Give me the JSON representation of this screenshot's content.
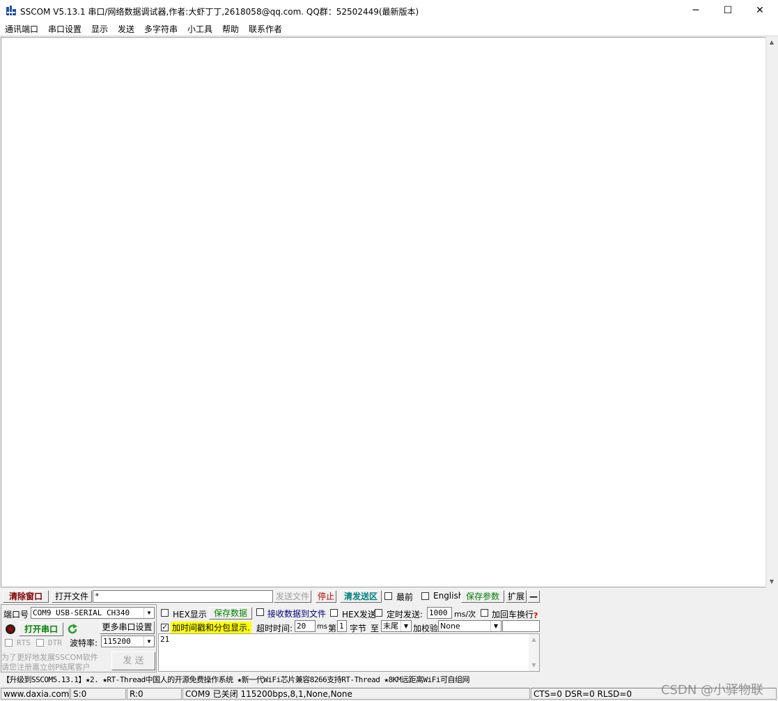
{
  "window": {
    "title": "SSCOM V5.13.1 串口/网络数据调试器,作者:大虾丁丁,2618058@qq.com. QQ群：52502449(最新版本)",
    "minimize_glyph": "─",
    "maximize_glyph": "☐",
    "close_glyph": "✕"
  },
  "menu": [
    "通讯端口",
    "串口设置",
    "显示",
    "发送",
    "多字符串",
    "小工具",
    "帮助",
    "联系作者"
  ],
  "toolbar": {
    "clear_window": "清除窗口",
    "open_file": "打开文件",
    "file_path": "*",
    "send_file": "发送文件",
    "stop": "停止",
    "clear_send": "清发送区",
    "topmost": "最前",
    "english": "English",
    "save_params": "保存参数",
    "expand": "扩展",
    "collapse": "—"
  },
  "port": {
    "port_label": "端口号",
    "port_value": "COM9 USB-SERIAL CH340",
    "open_port": "打开串口",
    "more_settings": "更多串口设置",
    "rts": "RTS",
    "dtr": "DTR",
    "baud_label": "波特率:",
    "baud_value": "115200",
    "promo_line1": "为了更好地发展SSCOM软件",
    "promo_line2": "请您注册嘉立创P结尾客户",
    "send_button": "发 送"
  },
  "options": {
    "hex_display": "HEX显示",
    "save_data": "保存数据",
    "recv_to_file": "接收数据到文件",
    "hex_send": "HEX发送",
    "timed_send": "定时发送:",
    "interval_value": "1000",
    "interval_unit": "ms/次",
    "add_crlf": "加回车换行",
    "timestamp": "加时间戳和分包显示.",
    "timeout_label": "超时时间:",
    "timeout_value": "20",
    "timeout_unit": "ms",
    "byte_prefix": "第",
    "byte_value": "1",
    "byte_suffix": "字节",
    "to_label": "至",
    "end_value": "末尾",
    "checksum_label": "加校验",
    "checksum_value": "None",
    "help_mark": "?"
  },
  "send_area": {
    "text": "21"
  },
  "ticker": "【升级到SSCOM5.13.1】★2. ★RT-Thread中国人的开源免费操作系统 ★新一代WiFi芯片兼容8266支持RT-Thread ★8KM远距离WiFi可自组网",
  "status": {
    "website": "www.daxia.com",
    "sent": "S:0",
    "received": "R:0",
    "port_state": "COM9 已关闭  115200bps,8,1,None,None",
    "lines": "CTS=0 DSR=0 RLSD=0"
  },
  "watermark": "CSDN @小驿物联",
  "colors": {
    "highlight_yellow": "#ffff00",
    "accent_green": "#008000",
    "accent_teal": "#008080",
    "accent_maroon": "#800000"
  }
}
